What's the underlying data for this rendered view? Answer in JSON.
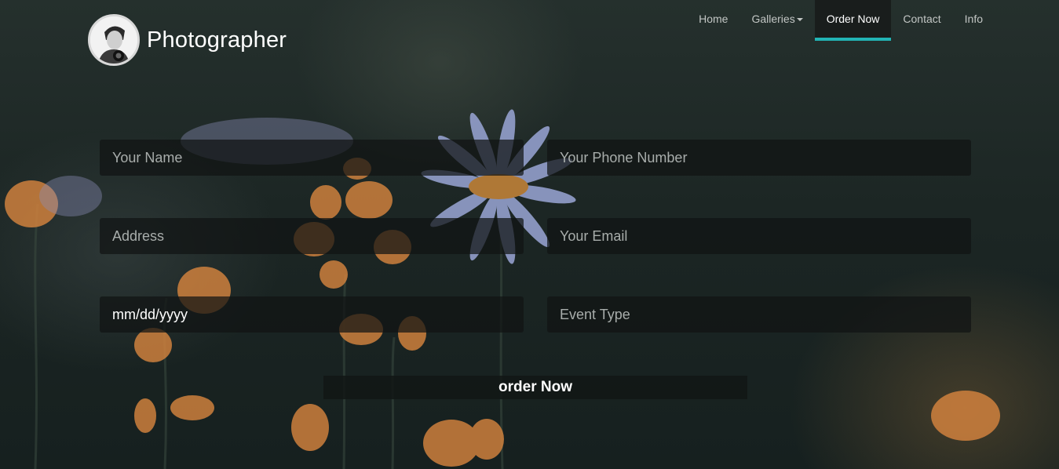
{
  "brand": {
    "title": "Photographer",
    "logo_icon": "photographer-avatar-icon"
  },
  "nav": {
    "items": [
      {
        "label": "Home"
      },
      {
        "label": "Galleries"
      },
      {
        "label": "Order Now"
      },
      {
        "label": "Contact"
      },
      {
        "label": "Info"
      }
    ],
    "active": "Order Now",
    "accent_color": "#22b3b4"
  },
  "form": {
    "name_placeholder": "Your Name",
    "phone_placeholder": "Your Phone Number",
    "address_placeholder": "Address",
    "email_placeholder": "Your Email",
    "date_placeholder": "mm/dd/yyyy",
    "event_placeholder": "Event Type",
    "submit_label": "order Now"
  }
}
